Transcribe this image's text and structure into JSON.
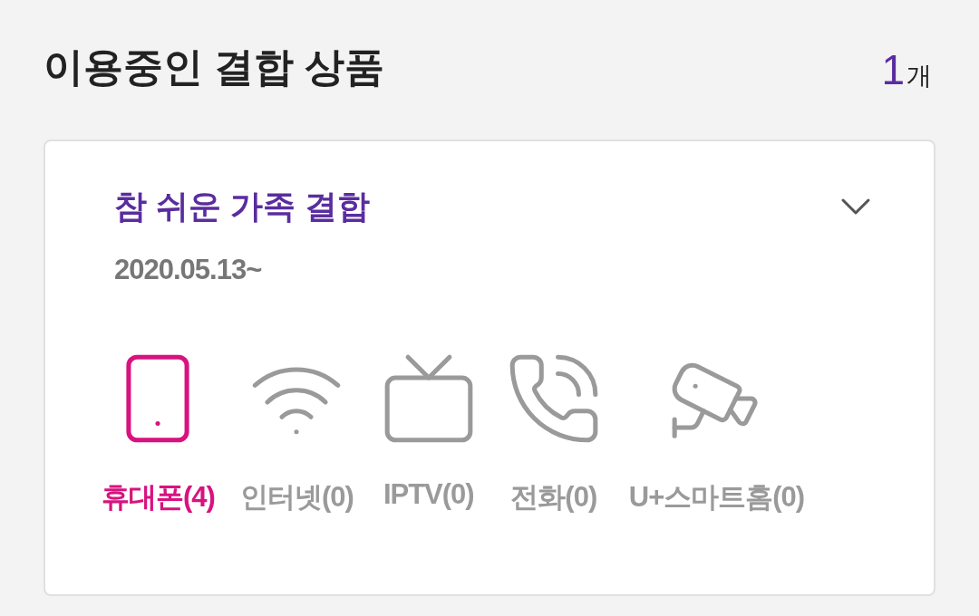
{
  "header": {
    "title": "이용중인 결합 상품",
    "count": "1",
    "count_unit": "개"
  },
  "card": {
    "title": "참 쉬운 가족 결합",
    "expanded": false,
    "date": "2020.05.13~",
    "services": [
      {
        "kind": "phone",
        "label": "휴대폰(4)",
        "selected": true
      },
      {
        "kind": "internet",
        "label": "인터넷(0)",
        "selected": false
      },
      {
        "kind": "tv",
        "label": "IPTV(0)",
        "selected": false
      },
      {
        "kind": "call",
        "label": "전화(0)",
        "selected": false
      },
      {
        "kind": "camera",
        "label": "U+스마트홈(0)",
        "selected": false
      }
    ]
  }
}
